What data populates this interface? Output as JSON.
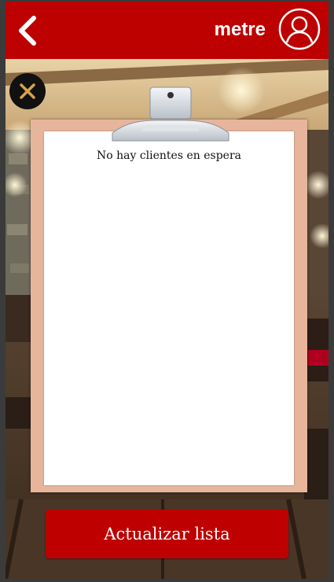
{
  "header": {
    "title": "metre",
    "back_icon": "chevron-left-icon",
    "avatar_icon": "user-avatar-icon"
  },
  "waitlist": {
    "empty_message": "No hay clientes en espera"
  },
  "actions": {
    "refresh_label": "Actualizar lista",
    "close_icon": "close-icon"
  },
  "colors": {
    "brand_red": "#bd0000",
    "board": "#e6b59c",
    "paper": "#ffffff",
    "close_x": "#d9a24a"
  }
}
